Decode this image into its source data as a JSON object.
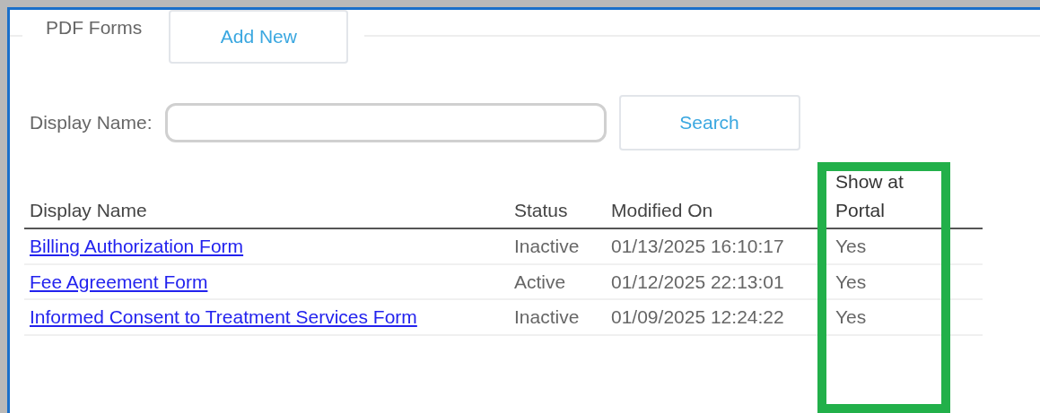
{
  "panel": {
    "title": "PDF Forms",
    "add_button": "Add New"
  },
  "search": {
    "label": "Display Name:",
    "button": "Search"
  },
  "table": {
    "columns": [
      {
        "label": "Display Name",
        "highlighted": false
      },
      {
        "label": "Status",
        "highlighted": false
      },
      {
        "label": "Modified On",
        "highlighted": false
      },
      {
        "label": "Show at Portal",
        "highlighted": true
      }
    ],
    "rows": [
      {
        "name": "Billing Authorization Form",
        "status": "Inactive",
        "modified": "01/13/2025 16:10:17",
        "portal": "Yes"
      },
      {
        "name": "Fee Agreement Form",
        "status": "Active",
        "modified": "01/12/2025 22:13:01",
        "portal": "Yes"
      },
      {
        "name": "Informed Consent to Treatment Services Form",
        "status": "Inactive",
        "modified": "01/09/2025 12:24:22",
        "portal": "Yes"
      }
    ]
  }
}
